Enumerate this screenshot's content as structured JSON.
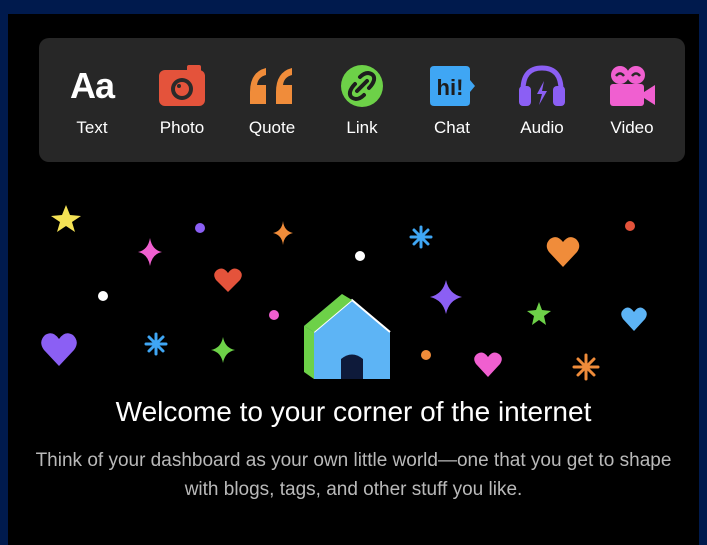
{
  "post_types": [
    {
      "label": "Text",
      "icon": "text-icon",
      "glyph": "Aa",
      "color": "#ffffff"
    },
    {
      "label": "Photo",
      "icon": "camera-icon",
      "color": "#e4533b"
    },
    {
      "label": "Quote",
      "icon": "quote-icon",
      "color": "#f08c3a"
    },
    {
      "label": "Link",
      "icon": "link-icon",
      "color": "#6dd148"
    },
    {
      "label": "Chat",
      "icon": "chat-icon",
      "glyph": "hi!",
      "color": "#3fa6f4"
    },
    {
      "label": "Audio",
      "icon": "headphones-icon",
      "color": "#8b5ff4"
    },
    {
      "label": "Video",
      "icon": "video-camera-icon",
      "color": "#f05fd0"
    }
  ],
  "welcome": {
    "title": "Welcome to your corner of the internet",
    "subtitle": "Think of your dashboard as your own little world—one that you get to shape with blogs, tags, and other stuff you like."
  }
}
